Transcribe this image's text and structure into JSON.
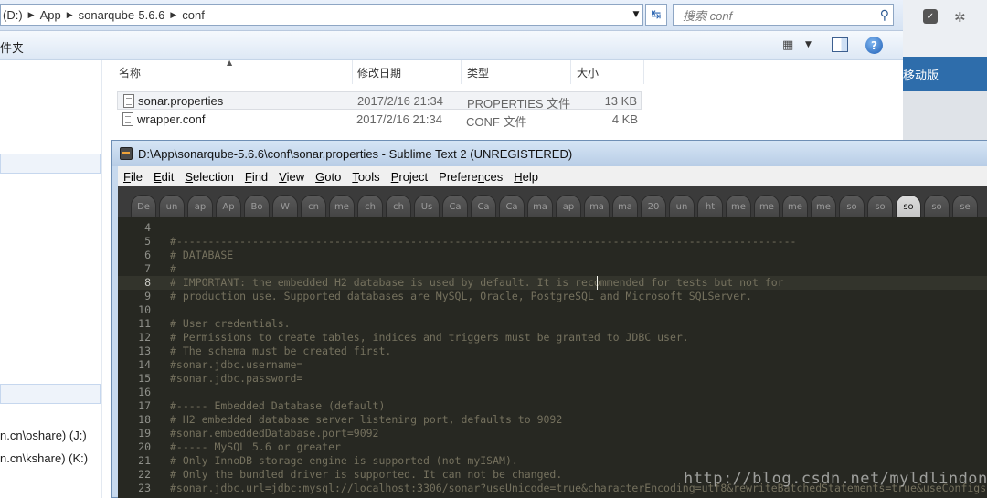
{
  "explorer": {
    "address": [
      "(D:)",
      "App",
      "sonarqube-5.6.6",
      "conf"
    ],
    "search_placeholder": "搜索 conf",
    "command_label": "件夹",
    "columns": {
      "name": "名称",
      "modified": "修改日期",
      "type": "类型",
      "size": "大小"
    },
    "files": [
      {
        "name": "sonar.properties",
        "modified": "2017/2/16 21:34",
        "type": "PROPERTIES 文件",
        "size": "13 KB"
      },
      {
        "name": "wrapper.conf",
        "modified": "2017/2/16 21:34",
        "type": "CONF 文件",
        "size": "4 KB"
      }
    ],
    "nav_items": [
      "n.cn\\oshare) (J:)",
      "n.cn\\kshare) (K:)"
    ]
  },
  "right_strip": {
    "banner": "移动版"
  },
  "sublime": {
    "title": "D:\\App\\sonarqube-5.6.6\\conf\\sonar.properties - Sublime Text 2 (UNREGISTERED)",
    "menu": [
      {
        "u": "F",
        "rest": "ile"
      },
      {
        "u": "E",
        "rest": "dit"
      },
      {
        "u": "S",
        "rest": "election"
      },
      {
        "u": "F",
        "rest": "ind"
      },
      {
        "u": "V",
        "rest": "iew"
      },
      {
        "u": "G",
        "rest": "oto"
      },
      {
        "u": "T",
        "rest": "ools"
      },
      {
        "u": "P",
        "rest": "roject"
      },
      {
        "u": "",
        "pre": "Prefere",
        "mid": "n",
        "rest": "ces"
      },
      {
        "u": "H",
        "rest": "elp"
      }
    ],
    "tabs": [
      "De",
      "un",
      "ap",
      "Ap",
      "Bo",
      "W",
      "cn",
      "me",
      "ch",
      "ch",
      "Us",
      "Ca",
      "Ca",
      "Ca",
      "ma",
      "ap",
      "ma",
      "ma",
      "20",
      "un",
      "ht",
      "me",
      "me",
      "me",
      "me",
      "so",
      "so",
      "so",
      "so",
      "se"
    ],
    "active_tab": 27,
    "lines": [
      {
        "n": "4",
        "t": ""
      },
      {
        "n": "5",
        "t": "#--------------------------------------------------------------------------------------------------"
      },
      {
        "n": "6",
        "t": "# DATABASE"
      },
      {
        "n": "7",
        "t": "#"
      },
      {
        "n": "8",
        "t": "# IMPORTANT: the embedded H2 database is used by default. It is recommended for tests but not for"
      },
      {
        "n": "9",
        "t": "# production use. Supported databases are MySQL, Oracle, PostgreSQL and Microsoft SQLServer."
      },
      {
        "n": "10",
        "t": ""
      },
      {
        "n": "11",
        "t": "# User credentials."
      },
      {
        "n": "12",
        "t": "# Permissions to create tables, indices and triggers must be granted to JDBC user."
      },
      {
        "n": "13",
        "t": "# The schema must be created first."
      },
      {
        "n": "14",
        "t": "#sonar.jdbc.username="
      },
      {
        "n": "15",
        "t": "#sonar.jdbc.password="
      },
      {
        "n": "16",
        "t": ""
      },
      {
        "n": "17",
        "t": "#----- Embedded Database (default)"
      },
      {
        "n": "18",
        "t": "# H2 embedded database server listening port, defaults to 9092"
      },
      {
        "n": "19",
        "t": "#sonar.embeddedDatabase.port=9092"
      },
      {
        "n": "20",
        "t": "#----- MySQL 5.6 or greater"
      },
      {
        "n": "21",
        "t": "# Only InnoDB storage engine is supported (not myISAM)."
      },
      {
        "n": "22",
        "t": "# Only the bundled driver is supported. It can not be changed."
      },
      {
        "n": "23",
        "t": "#sonar.jdbc.url=jdbc:mysql://localhost:3306/sonar?useUnicode=true&characterEncoding=utf8&rewriteBatchedStatements=true&useConfigs"
      }
    ],
    "current_line": 4
  },
  "watermark": "http://blog.csdn.net/myldlindong"
}
